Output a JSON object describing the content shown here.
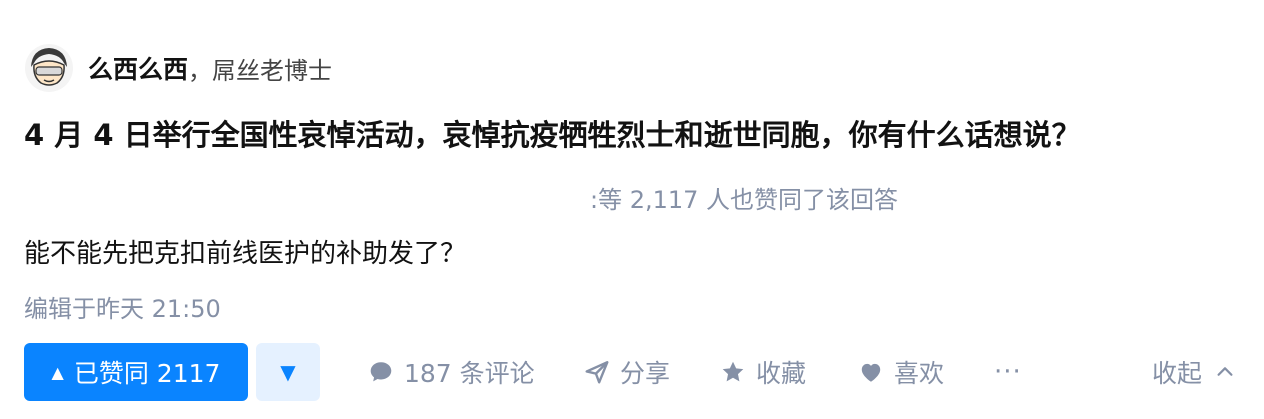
{
  "author": {
    "name": "么西么西",
    "separator": "，",
    "bio": "屌丝老博士",
    "avatar_icon": "cartoon-face-icon"
  },
  "question": {
    "title": "4 月 4 日举行全国性哀悼活动，哀悼抗疫牺牲烈士和逝世同胞，你有什么话想说？"
  },
  "answer": {
    "approvals_text": ":等 2,117 人也赞同了该回答",
    "content": "能不能先把克扣前线医护的补助发了？",
    "edited_time": "编辑于昨天 21:50"
  },
  "actions": {
    "vote_up_label": "已赞同 2117",
    "vote_up_icon": "triangle-up-icon",
    "vote_down_icon": "triangle-down-icon",
    "comments_label": "187 条评论",
    "comments_icon": "comment-bubble-icon",
    "share_label": "分享",
    "share_icon": "paper-plane-icon",
    "favorite_label": "收藏",
    "favorite_icon": "star-icon",
    "like_label": "喜欢",
    "like_icon": "heart-icon",
    "more_label": "···",
    "collapse_label": "收起",
    "collapse_icon": "chevron-up-icon"
  },
  "colors": {
    "accent": "#0a84ff",
    "accent_light": "#e5f1ff",
    "muted": "#8590a6",
    "text": "#121212"
  }
}
